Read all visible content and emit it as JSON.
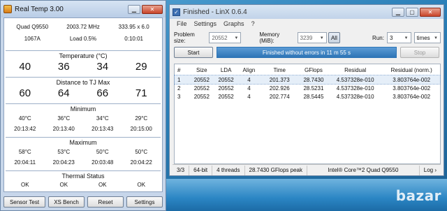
{
  "realtemp": {
    "title": "Real Temp 3.00",
    "cpu": "Quad Q9550",
    "freq": "2003.72 MHz",
    "multi": "333.95 x 6.0",
    "vid": "1067A",
    "load": "Load  0.5%",
    "time": "0:10:01",
    "temp_label": "Temperature (°C)",
    "temps": [
      "40",
      "36",
      "34",
      "29"
    ],
    "dist_label": "Distance to TJ Max",
    "dists": [
      "60",
      "64",
      "66",
      "71"
    ],
    "min_label": "Minimum",
    "min_temps": [
      "40°C",
      "36°C",
      "34°C",
      "29°C"
    ],
    "min_times": [
      "20:13:42",
      "20:13:40",
      "20:13:43",
      "20:15:00"
    ],
    "max_label": "Maximum",
    "max_temps": [
      "58°C",
      "53°C",
      "50°C",
      "50°C"
    ],
    "max_times": [
      "20:04:11",
      "20:04:23",
      "20:03:48",
      "20:04:22"
    ],
    "status_label": "Thermal Status",
    "status": [
      "OK",
      "OK",
      "OK",
      "OK"
    ],
    "buttons": [
      "Sensor Test",
      "XS Bench",
      "Reset",
      "Settings"
    ]
  },
  "linx": {
    "title": "Finished - LinX 0.6.4",
    "menu": [
      "File",
      "Settings",
      "Graphs",
      "?"
    ],
    "problem_size_label": "Problem size:",
    "problem_size": "20552",
    "memory_label": "Memory (MiB):",
    "memory": "3239",
    "all_button": "All",
    "run_label": "Run:",
    "run_value": "3",
    "run_unit": "times",
    "start_button": "Start",
    "stop_button": "Stop",
    "progress_text": "Finished without errors in 11 m 55 s",
    "progress_fraction": 1.0,
    "columns": [
      "#",
      "Size",
      "LDA",
      "Align",
      "Time",
      "GFlops",
      "Residual",
      "Residual (norm.)"
    ],
    "rows": [
      [
        "1",
        "20552",
        "20552",
        "4",
        "201.373",
        "28.7430",
        "4.537328e-010",
        "3.803764e-002"
      ],
      [
        "2",
        "20552",
        "20552",
        "4",
        "202.926",
        "28.5231",
        "4.537328e-010",
        "3.803764e-002"
      ],
      [
        "3",
        "20552",
        "20552",
        "4",
        "202.774",
        "28.5445",
        "4.537328e-010",
        "3.803764e-002"
      ]
    ],
    "status": {
      "progress": "3/3",
      "bits": "64-bit",
      "threads": "4 threads",
      "peak": "28.7430 GFlops peak",
      "cpu": "Intel® Core™2 Quad Q9550",
      "log": "Log ›"
    }
  },
  "watermark": "bazar"
}
